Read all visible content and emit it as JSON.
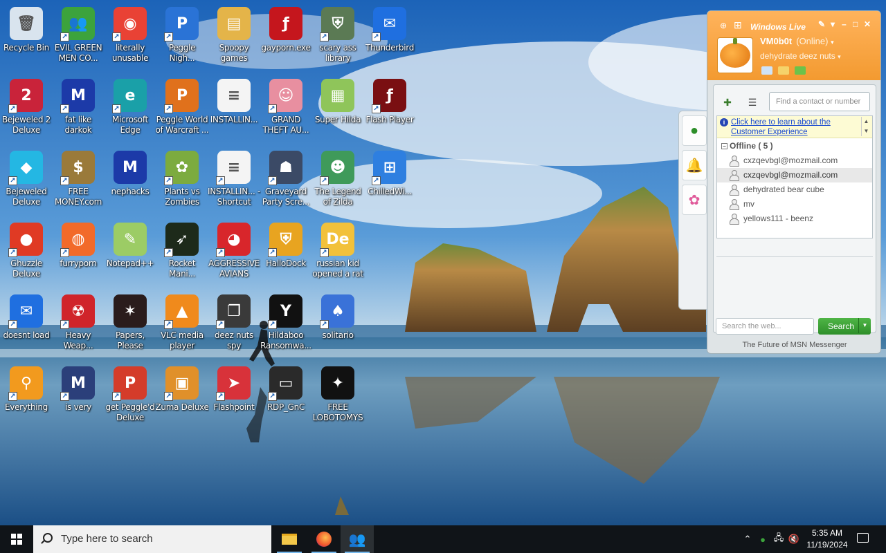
{
  "desktop": {
    "icons": [
      {
        "label": "Recycle Bin",
        "icon": "recycle-bin-icon",
        "color": "#d9e4ee",
        "glyph": "🗑",
        "shortcut": false
      },
      {
        "label": "EVIL GREEN MEN CO...",
        "icon": "msn-buddies-icon",
        "color": "#3ca33c",
        "glyph": "👥",
        "shortcut": true
      },
      {
        "label": "literally unusable",
        "icon": "chrome-icon",
        "color": "#e94235",
        "glyph": "◉",
        "shortcut": true
      },
      {
        "label": "Peggle Nigh...",
        "icon": "peggle-icon",
        "color": "#2a73d6",
        "glyph": "P",
        "shortcut": true
      },
      {
        "label": "Spoopy games",
        "icon": "folder-icon",
        "color": "#e4b449",
        "glyph": "▤",
        "shortcut": false
      },
      {
        "label": "gayporn.exe",
        "icon": "flash-icon",
        "color": "#c5161d",
        "glyph": "ƒ",
        "shortcut": false
      },
      {
        "label": "scary ass library",
        "icon": "library-icon",
        "color": "#5b7a54",
        "glyph": "⛨",
        "shortcut": true
      },
      {
        "label": "Thunderbird",
        "icon": "thunderbird-icon",
        "color": "#1f6fe0",
        "glyph": "✉",
        "shortcut": true
      },
      {
        "label": "Bejeweled 2 Deluxe",
        "icon": "bejeweled2-icon",
        "color": "#c9233a",
        "glyph": "2",
        "shortcut": true
      },
      {
        "label": "fat like darkok",
        "icon": "mpi-icon",
        "color": "#1c3aa8",
        "glyph": "M",
        "shortcut": true
      },
      {
        "label": "Microsoft Edge",
        "icon": "edge-icon",
        "color": "#1aa0a8",
        "glyph": "e",
        "shortcut": true
      },
      {
        "label": "Peggle World of Warcraft ...",
        "icon": "peggle-wow-icon",
        "color": "#e0711c",
        "glyph": "P",
        "shortcut": true
      },
      {
        "label": "INSTALLIN...",
        "icon": "text-file-icon",
        "color": "#f4f4f4",
        "glyph": "≡",
        "shortcut": false
      },
      {
        "label": "GRAND THEFT AU...",
        "icon": "anime-girl-icon",
        "color": "#e88fa0",
        "glyph": "☺",
        "shortcut": true
      },
      {
        "label": "Super Hilda",
        "icon": "super-hilda-icon",
        "color": "#8fc55a",
        "glyph": "▦",
        "shortcut": false
      },
      {
        "label": "Flash Player",
        "icon": "flash-player-icon",
        "color": "#7a0f12",
        "glyph": "ƒ",
        "shortcut": true
      },
      {
        "label": "Bejeweled Deluxe",
        "icon": "gem-icon",
        "color": "#24b7e3",
        "glyph": "◆",
        "shortcut": true
      },
      {
        "label": "FREE MONEY.com",
        "icon": "money-bag-icon",
        "color": "#9a7a3a",
        "glyph": "$",
        "shortcut": true
      },
      {
        "label": "nephacks",
        "icon": "mpi-icon",
        "color": "#1c3aa8",
        "glyph": "M",
        "shortcut": false
      },
      {
        "label": "Plants vs Zombies",
        "icon": "plants-vs-zombies-icon",
        "color": "#7cab3f",
        "glyph": "✿",
        "shortcut": true
      },
      {
        "label": "INSTALLIN... - Shortcut",
        "icon": "text-file-icon",
        "color": "#f4f4f4",
        "glyph": "≡",
        "shortcut": true
      },
      {
        "label": "Graveyard Party Scre...",
        "icon": "graveyard-icon",
        "color": "#3b4a66",
        "glyph": "☗",
        "shortcut": true
      },
      {
        "label": "The Legend of Zilda",
        "icon": "zilda-icon",
        "color": "#3f9a5a",
        "glyph": "☻",
        "shortcut": true
      },
      {
        "label": "ChilledWi...",
        "icon": "windows-xp-icon",
        "color": "#2e7fe0",
        "glyph": "⊞",
        "shortcut": true
      },
      {
        "label": "Ghuzzle Deluxe",
        "icon": "zuma-frog-icon",
        "color": "#e03a24",
        "glyph": "●",
        "shortcut": true
      },
      {
        "label": "furryporn",
        "icon": "firefox-icon",
        "color": "#f26a2a",
        "glyph": "◍",
        "shortcut": true
      },
      {
        "label": "Notepad++",
        "icon": "notepad-plus-icon",
        "color": "#9ccc65",
        "glyph": "✎",
        "shortcut": false
      },
      {
        "label": "Rocket Mani...",
        "icon": "rocket-icon",
        "color": "#1d2a1a",
        "glyph": "➶",
        "shortcut": true
      },
      {
        "label": "AGGRESSIVE AVIANS",
        "icon": "angry-bird-icon",
        "color": "#d8262b",
        "glyph": "◕",
        "shortcut": true
      },
      {
        "label": "HalloDock",
        "icon": "shield-icon",
        "color": "#e8a420",
        "glyph": "⛨",
        "shortcut": true
      },
      {
        "label": "russian kid opened a rat",
        "icon": "de-icon",
        "color": "#f2c13b",
        "glyph": "De",
        "shortcut": true
      },
      {
        "label": "",
        "icon": "",
        "color": "",
        "glyph": "",
        "shortcut": false
      },
      {
        "label": "doesnt load",
        "icon": "thunderbird-icon",
        "color": "#1f6fe0",
        "glyph": "✉",
        "shortcut": true
      },
      {
        "label": "Heavy Weap...",
        "icon": "radiation-icon",
        "color": "#d0242a",
        "glyph": "☢",
        "shortcut": true
      },
      {
        "label": "Papers, Please",
        "icon": "papers-please-icon",
        "color": "#2a1c1c",
        "glyph": "✶",
        "shortcut": false
      },
      {
        "label": "VLC media player",
        "icon": "vlc-icon",
        "color": "#f08a1c",
        "glyph": "▲",
        "shortcut": true
      },
      {
        "label": "deez nuts spy",
        "icon": "stacked-windows-icon",
        "color": "#3a3a3a",
        "glyph": "❐",
        "shortcut": true
      },
      {
        "label": "Hildaboo Ransomwa...",
        "icon": "yashma-icon",
        "color": "#111111",
        "glyph": "Y",
        "shortcut": true
      },
      {
        "label": "solitario",
        "icon": "solitaire-icon",
        "color": "#3a72d8",
        "glyph": "♠",
        "shortcut": true
      },
      {
        "label": "",
        "icon": "",
        "color": "",
        "glyph": "",
        "shortcut": false
      },
      {
        "label": "Everything",
        "icon": "magnifier-icon",
        "color": "#f29a1e",
        "glyph": "⚲",
        "shortcut": true
      },
      {
        "label": "is very",
        "icon": "mpi-shield-icon",
        "color": "#2b3f7a",
        "glyph": "M",
        "shortcut": true
      },
      {
        "label": "get Peggle'd Deluxe",
        "icon": "peggle-icon",
        "color": "#d43c2a",
        "glyph": "P",
        "shortcut": true
      },
      {
        "label": "Zuma Deluxe",
        "icon": "zuma-icon",
        "color": "#e0902a",
        "glyph": "▣",
        "shortcut": true
      },
      {
        "label": "Flashpoint",
        "icon": "flashpoint-icon",
        "color": "#d8323a",
        "glyph": "➤",
        "shortcut": true
      },
      {
        "label": "RDP_GnC",
        "icon": "remote-desktop-icon",
        "color": "#2a2a2a",
        "glyph": "▭",
        "shortcut": true
      },
      {
        "label": "FREE LOBOTOMYS",
        "icon": "lobotomy-icon",
        "color": "#111111",
        "glyph": "✦",
        "shortcut": false
      },
      {
        "label": "",
        "icon": "",
        "color": "",
        "glyph": "",
        "shortcut": false
      }
    ]
  },
  "messenger": {
    "title": "Windows Live",
    "display_name": "VM0b0t",
    "status": "(Online)",
    "personal_message": "dehydrate deez nuts",
    "search_contacts_placeholder": "Find a contact or number",
    "info_link": "Click here to learn about the Customer Experience",
    "group": {
      "name": "Offline",
      "count": "( 5 )"
    },
    "contacts": [
      {
        "name": "cxzqevbgl@mozmail.com",
        "selected": false
      },
      {
        "name": "cxzqevbgl@mozmail.com",
        "selected": true
      },
      {
        "name": "dehydrated bear cube",
        "selected": false
      },
      {
        "name": "mv",
        "selected": false
      },
      {
        "name": "yellows111 - beenz",
        "selected": false
      }
    ],
    "web_search_placeholder": "Search the web...",
    "search_button": "Search",
    "footer": "The Future of MSN Messenger",
    "accent": "#f39a30"
  },
  "taskbar": {
    "search_placeholder": "Type here to search",
    "time": "5:35 AM",
    "date": "11/19/2024",
    "apps": [
      "file-explorer-icon",
      "firefox-icon",
      "messenger-icon"
    ]
  }
}
